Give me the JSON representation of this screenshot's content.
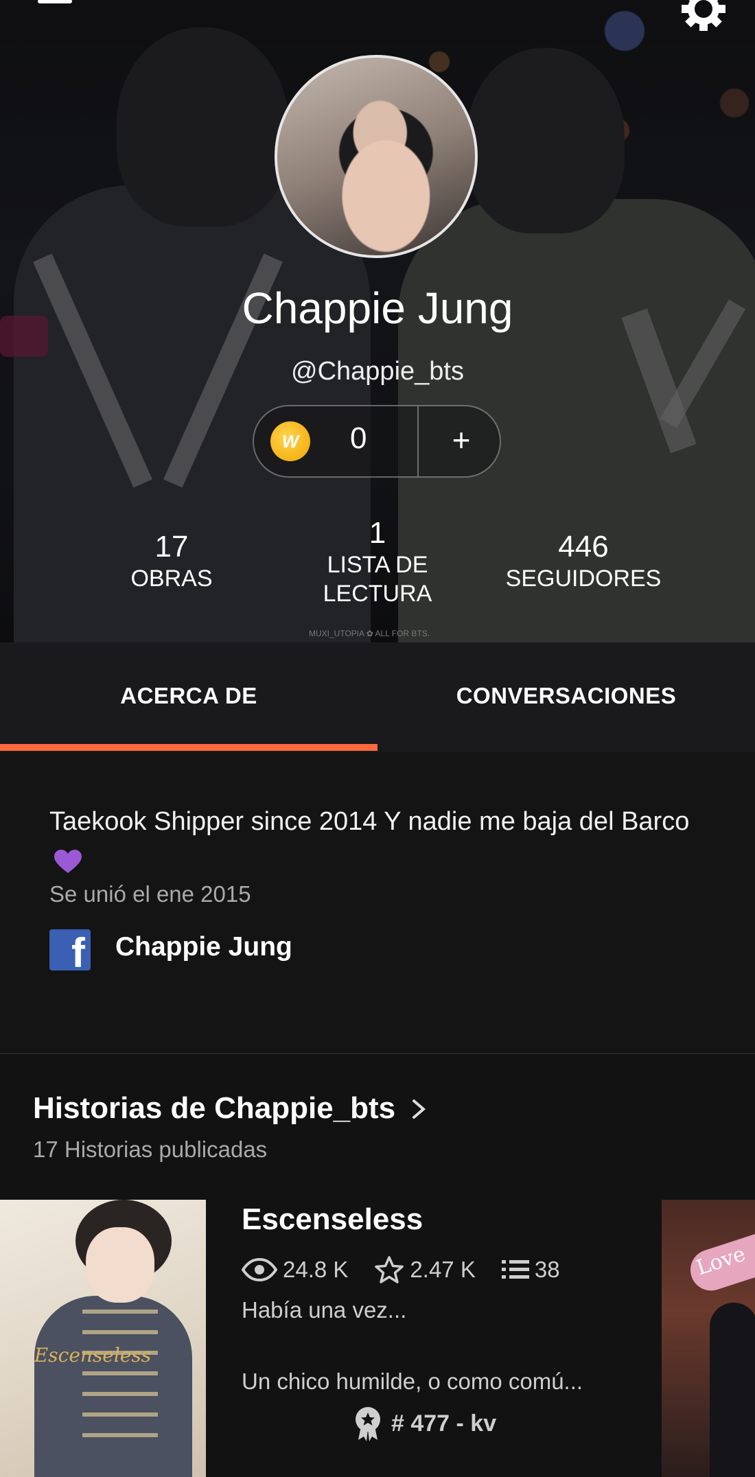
{
  "profile": {
    "name": "Chappie Jung",
    "handle": "@Chappie_bts",
    "coins": "0",
    "coin_add": "+",
    "coin_letter": "W"
  },
  "stats": {
    "works": {
      "value": "17",
      "label": "OBRAS"
    },
    "reading_lists": {
      "value": "1",
      "label_line1": "LISTA DE",
      "label_line2": "LECTURA"
    },
    "followers": {
      "value": "446",
      "label": "SEGUIDORES"
    }
  },
  "cover_watermark": "MUXI_UTOPIA  ✿  ALL FOR BTS.",
  "tabs": [
    {
      "label": "ACERCA DE",
      "active": true
    },
    {
      "label": "CONVERSACIONES",
      "active": false
    }
  ],
  "about": {
    "bio": "Taekook Shipper since 2014 Y nadie me baja del Barco",
    "joined": "Se unió el ene 2015",
    "facebook_name": "Chappie Jung"
  },
  "stories": {
    "title": "Historias de Chappie_bts",
    "count": "17 Historias publicadas",
    "items": [
      {
        "title": "Escenseless",
        "cover_text": "Escenseless",
        "reads": "24.8 K",
        "votes": "2.47 K",
        "parts": "38",
        "desc_line1": "Había una vez...",
        "desc_line2": "Un chico humilde, o como comú...",
        "rank": "# 477 - kv"
      },
      {
        "cover_text": "Love"
      }
    ]
  },
  "colors": {
    "accent": "#ff6a3d",
    "background": "#121212",
    "facebook": "#3a5fb3",
    "heart": "#9b59d6",
    "coin": "#f0a500"
  }
}
